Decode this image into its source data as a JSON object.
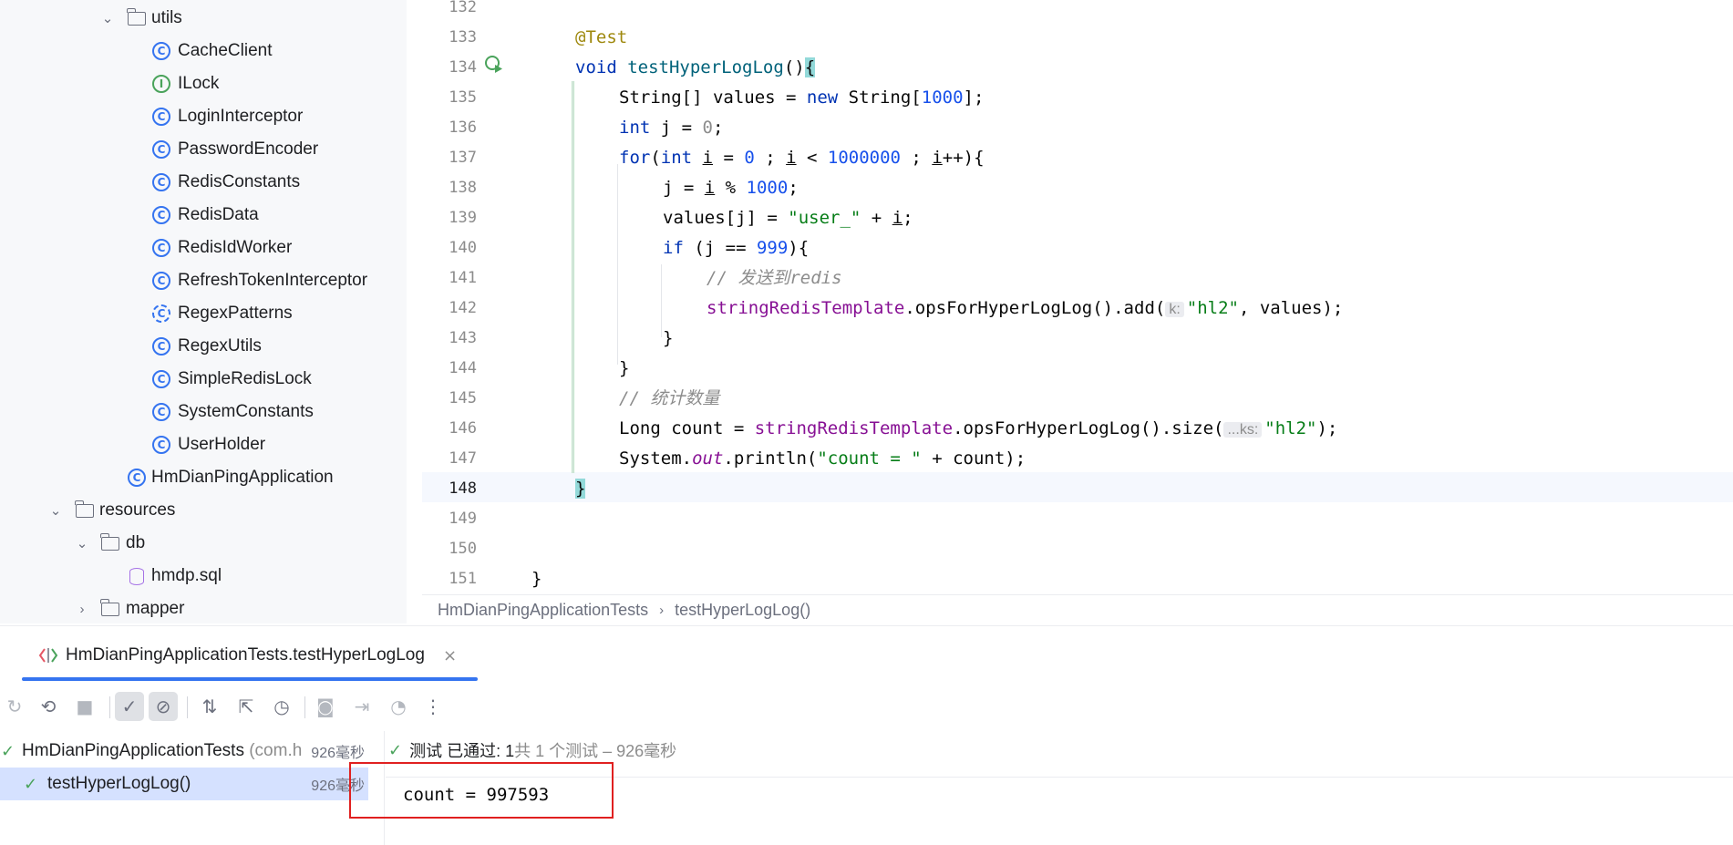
{
  "project_tree": {
    "items": [
      {
        "label": "utils",
        "kind": "package",
        "expanded": true
      },
      {
        "label": "CacheClient",
        "kind": "class"
      },
      {
        "label": "ILock",
        "kind": "interface"
      },
      {
        "label": "LoginInterceptor",
        "kind": "class"
      },
      {
        "label": "PasswordEncoder",
        "kind": "class"
      },
      {
        "label": "RedisConstants",
        "kind": "class"
      },
      {
        "label": "RedisData",
        "kind": "class"
      },
      {
        "label": "RedisIdWorker",
        "kind": "class"
      },
      {
        "label": "RefreshTokenInterceptor",
        "kind": "class"
      },
      {
        "label": "RegexPatterns",
        "kind": "class"
      },
      {
        "label": "RegexUtils",
        "kind": "class"
      },
      {
        "label": "SimpleRedisLock",
        "kind": "class"
      },
      {
        "label": "SystemConstants",
        "kind": "class"
      },
      {
        "label": "UserHolder",
        "kind": "class"
      },
      {
        "label": "HmDianPingApplication",
        "kind": "spring-app-class"
      },
      {
        "label": "resources",
        "kind": "resources-folder",
        "expanded": true
      },
      {
        "label": "db",
        "kind": "folder",
        "expanded": true
      },
      {
        "label": "hmdp.sql",
        "kind": "sql-file"
      },
      {
        "label": "mapper",
        "kind": "folder",
        "expanded": false
      }
    ]
  },
  "editor": {
    "line_numbers": [
      "132",
      "133",
      "134",
      "135",
      "136",
      "137",
      "138",
      "139",
      "140",
      "141",
      "142",
      "143",
      "144",
      "145",
      "146",
      "147",
      "148",
      "149",
      "150",
      "151"
    ],
    "current_line": "148",
    "code": {
      "l133_annotation": "@Test",
      "l134_kw": "void",
      "l134_method": "testHyperLogLog",
      "l134_rest": "()",
      "l134_brace": "{",
      "l135_a": "String[] values = ",
      "l135_kw": "new",
      "l135_b": " String[",
      "l135_num": "1000",
      "l135_c": "];",
      "l136_kw": "int",
      "l136_a": " j = ",
      "l136_num": "0",
      "l136_b": ";",
      "l137_kw": "for",
      "l137_a": "(",
      "l137_kw2": "int",
      "l137_b": " ",
      "l137_i1": "i",
      "l137_c": " = ",
      "l137_n1": "0",
      "l137_d": " ; ",
      "l137_i2": "i",
      "l137_e": " < ",
      "l137_n2": "1000000",
      "l137_f": " ; ",
      "l137_i3": "i",
      "l137_g": "++){",
      "l138_a": "j = ",
      "l138_i": "i",
      "l138_b": " % ",
      "l138_num": "1000",
      "l138_c": ";",
      "l139_a": "values[j] = ",
      "l139_str": "\"user_\"",
      "l139_b": " + ",
      "l139_i": "i",
      "l139_c": ";",
      "l140_kw": "if",
      "l140_a": " (j == ",
      "l140_num": "999",
      "l140_b": "){",
      "l141_comment": "// 发送到redis",
      "l142_field": "stringRedisTemplate",
      "l142_a": ".opsForHyperLogLog().add(",
      "l142_hint": "k:",
      "l142_str": "\"hl2\"",
      "l142_b": ", values);",
      "l143": "}",
      "l144": "}",
      "l145_comment": "// 统计数量",
      "l146_a": "Long count = ",
      "l146_field": "stringRedisTemplate",
      "l146_b": ".opsForHyperLogLog().size(",
      "l146_hint": "...ks:",
      "l146_str": "\"hl2\"",
      "l146_c": ");",
      "l147_a": "System.",
      "l147_static": "out",
      "l147_b": ".println(",
      "l147_str": "\"count = \"",
      "l147_c": " + count);",
      "l148_brace": "}",
      "l151": "}"
    }
  },
  "breadcrumb": {
    "class": "HmDianPingApplicationTests",
    "method": "testHyperLogLog()"
  },
  "run_window": {
    "tab_label": "HmDianPingApplicationTests.testHyperLogLog",
    "tree": {
      "root_name": "HmDianPingApplicationTests",
      "root_pkg": " (com.h",
      "root_time": "926毫秒",
      "child_name": "testHyperLogLog()",
      "child_time": "926毫秒"
    },
    "status": {
      "prefix": "测试 已通过: 1",
      "suffix": "共 1 个测试 – 926毫秒"
    },
    "console_output": "count = 997593"
  },
  "colors": {
    "accent": "#3574f0",
    "passed": "#4aa35b",
    "highlight_box": "#e02020"
  }
}
